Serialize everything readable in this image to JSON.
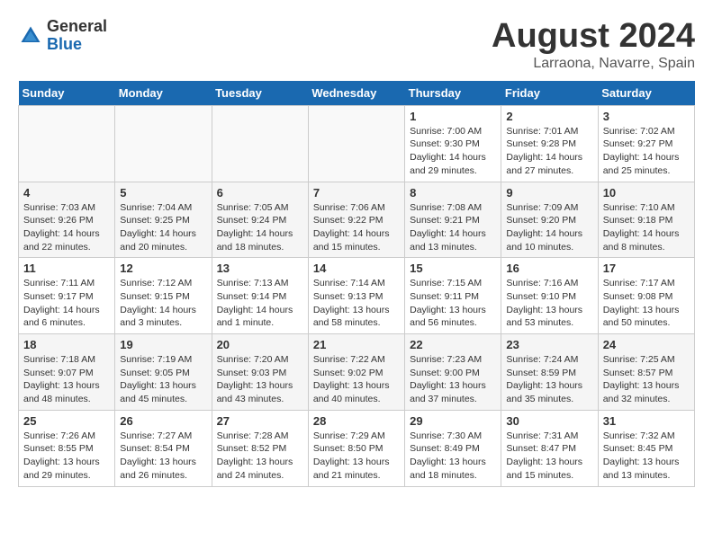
{
  "header": {
    "logo_general": "General",
    "logo_blue": "Blue",
    "month_title": "August 2024",
    "location": "Larraona, Navarre, Spain"
  },
  "weekdays": [
    "Sunday",
    "Monday",
    "Tuesday",
    "Wednesday",
    "Thursday",
    "Friday",
    "Saturday"
  ],
  "weeks": [
    [
      {
        "day": "",
        "info": ""
      },
      {
        "day": "",
        "info": ""
      },
      {
        "day": "",
        "info": ""
      },
      {
        "day": "",
        "info": ""
      },
      {
        "day": "1",
        "info": "Sunrise: 7:00 AM\nSunset: 9:30 PM\nDaylight: 14 hours\nand 29 minutes."
      },
      {
        "day": "2",
        "info": "Sunrise: 7:01 AM\nSunset: 9:28 PM\nDaylight: 14 hours\nand 27 minutes."
      },
      {
        "day": "3",
        "info": "Sunrise: 7:02 AM\nSunset: 9:27 PM\nDaylight: 14 hours\nand 25 minutes."
      }
    ],
    [
      {
        "day": "4",
        "info": "Sunrise: 7:03 AM\nSunset: 9:26 PM\nDaylight: 14 hours\nand 22 minutes."
      },
      {
        "day": "5",
        "info": "Sunrise: 7:04 AM\nSunset: 9:25 PM\nDaylight: 14 hours\nand 20 minutes."
      },
      {
        "day": "6",
        "info": "Sunrise: 7:05 AM\nSunset: 9:24 PM\nDaylight: 14 hours\nand 18 minutes."
      },
      {
        "day": "7",
        "info": "Sunrise: 7:06 AM\nSunset: 9:22 PM\nDaylight: 14 hours\nand 15 minutes."
      },
      {
        "day": "8",
        "info": "Sunrise: 7:08 AM\nSunset: 9:21 PM\nDaylight: 14 hours\nand 13 minutes."
      },
      {
        "day": "9",
        "info": "Sunrise: 7:09 AM\nSunset: 9:20 PM\nDaylight: 14 hours\nand 10 minutes."
      },
      {
        "day": "10",
        "info": "Sunrise: 7:10 AM\nSunset: 9:18 PM\nDaylight: 14 hours\nand 8 minutes."
      }
    ],
    [
      {
        "day": "11",
        "info": "Sunrise: 7:11 AM\nSunset: 9:17 PM\nDaylight: 14 hours\nand 6 minutes."
      },
      {
        "day": "12",
        "info": "Sunrise: 7:12 AM\nSunset: 9:15 PM\nDaylight: 14 hours\nand 3 minutes."
      },
      {
        "day": "13",
        "info": "Sunrise: 7:13 AM\nSunset: 9:14 PM\nDaylight: 14 hours\nand 1 minute."
      },
      {
        "day": "14",
        "info": "Sunrise: 7:14 AM\nSunset: 9:13 PM\nDaylight: 13 hours\nand 58 minutes."
      },
      {
        "day": "15",
        "info": "Sunrise: 7:15 AM\nSunset: 9:11 PM\nDaylight: 13 hours\nand 56 minutes."
      },
      {
        "day": "16",
        "info": "Sunrise: 7:16 AM\nSunset: 9:10 PM\nDaylight: 13 hours\nand 53 minutes."
      },
      {
        "day": "17",
        "info": "Sunrise: 7:17 AM\nSunset: 9:08 PM\nDaylight: 13 hours\nand 50 minutes."
      }
    ],
    [
      {
        "day": "18",
        "info": "Sunrise: 7:18 AM\nSunset: 9:07 PM\nDaylight: 13 hours\nand 48 minutes."
      },
      {
        "day": "19",
        "info": "Sunrise: 7:19 AM\nSunset: 9:05 PM\nDaylight: 13 hours\nand 45 minutes."
      },
      {
        "day": "20",
        "info": "Sunrise: 7:20 AM\nSunset: 9:03 PM\nDaylight: 13 hours\nand 43 minutes."
      },
      {
        "day": "21",
        "info": "Sunrise: 7:22 AM\nSunset: 9:02 PM\nDaylight: 13 hours\nand 40 minutes."
      },
      {
        "day": "22",
        "info": "Sunrise: 7:23 AM\nSunset: 9:00 PM\nDaylight: 13 hours\nand 37 minutes."
      },
      {
        "day": "23",
        "info": "Sunrise: 7:24 AM\nSunset: 8:59 PM\nDaylight: 13 hours\nand 35 minutes."
      },
      {
        "day": "24",
        "info": "Sunrise: 7:25 AM\nSunset: 8:57 PM\nDaylight: 13 hours\nand 32 minutes."
      }
    ],
    [
      {
        "day": "25",
        "info": "Sunrise: 7:26 AM\nSunset: 8:55 PM\nDaylight: 13 hours\nand 29 minutes."
      },
      {
        "day": "26",
        "info": "Sunrise: 7:27 AM\nSunset: 8:54 PM\nDaylight: 13 hours\nand 26 minutes."
      },
      {
        "day": "27",
        "info": "Sunrise: 7:28 AM\nSunset: 8:52 PM\nDaylight: 13 hours\nand 24 minutes."
      },
      {
        "day": "28",
        "info": "Sunrise: 7:29 AM\nSunset: 8:50 PM\nDaylight: 13 hours\nand 21 minutes."
      },
      {
        "day": "29",
        "info": "Sunrise: 7:30 AM\nSunset: 8:49 PM\nDaylight: 13 hours\nand 18 minutes."
      },
      {
        "day": "30",
        "info": "Sunrise: 7:31 AM\nSunset: 8:47 PM\nDaylight: 13 hours\nand 15 minutes."
      },
      {
        "day": "31",
        "info": "Sunrise: 7:32 AM\nSunset: 8:45 PM\nDaylight: 13 hours\nand 13 minutes."
      }
    ]
  ]
}
